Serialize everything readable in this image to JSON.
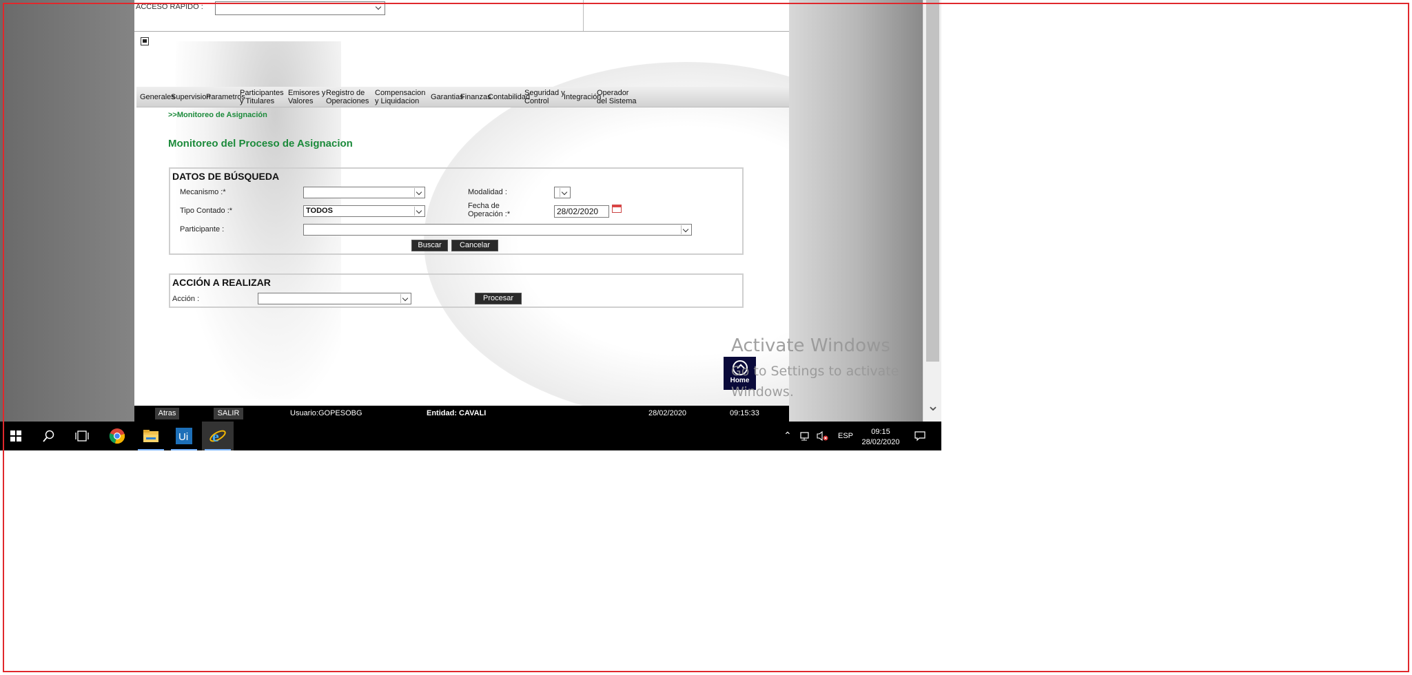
{
  "quick_access": {
    "label": "ACCESO RAPIDO :",
    "value": ""
  },
  "menu": [
    {
      "label": "Generales"
    },
    {
      "label": "Supervision"
    },
    {
      "label": "Parametros"
    },
    {
      "label": "Participantes y Titulares"
    },
    {
      "label": "Emisores y Valores"
    },
    {
      "label": "Registro de Operaciones"
    },
    {
      "label": "Compensacion y Liquidacion"
    },
    {
      "label": "Garantias"
    },
    {
      "label": "Finanzas"
    },
    {
      "label": "Contabilidad"
    },
    {
      "label": "Seguridad y Control"
    },
    {
      "label": "Integración"
    },
    {
      "label": "Operador del Sistema"
    }
  ],
  "breadcrumb": ">>Monitoreo de Asignación",
  "page_title": "Monitoreo del Proceso de Asignacion",
  "search": {
    "title": "DATOS DE BÚSQUEDA",
    "mecanismo_label": "Mecanismo :*",
    "mecanismo_value": "",
    "modalidad_label": "Modalidad :",
    "modalidad_value": "",
    "tipo_contado_label": "Tipo Contado :*",
    "tipo_contado_value": "TODOS",
    "fecha_label_1": "Fecha de",
    "fecha_label_2": "Operación :*",
    "fecha_value": "28/02/2020",
    "participante_label": "Participante :",
    "participante_value": "",
    "buscar": "Buscar",
    "cancelar": "Cancelar"
  },
  "action": {
    "title": "ACCIÓN A REALIZAR",
    "accion_label": "Acción :",
    "accion_value": "",
    "procesar": "Procesar"
  },
  "watermark": {
    "line1": "Activate Windows",
    "line2": "Go to Settings to activate",
    "line3": "Windows."
  },
  "home_tile": "Home",
  "statusbar": {
    "atras": "Atras",
    "salir": "SALIR",
    "usuario": "Usuario:GOPESOBG",
    "entidad": "Entidad: CAVALI",
    "fecha": "28/02/2020",
    "hora": "09:15:33"
  },
  "taskbar": {
    "icons": [
      "windows-start-icon",
      "search-icon",
      "task-view-icon",
      "chrome-icon",
      "file-explorer-icon",
      "uipath-icon",
      "internet-explorer-icon"
    ],
    "lang": "ESP",
    "time": "09:15",
    "date": "28/02/2020"
  }
}
